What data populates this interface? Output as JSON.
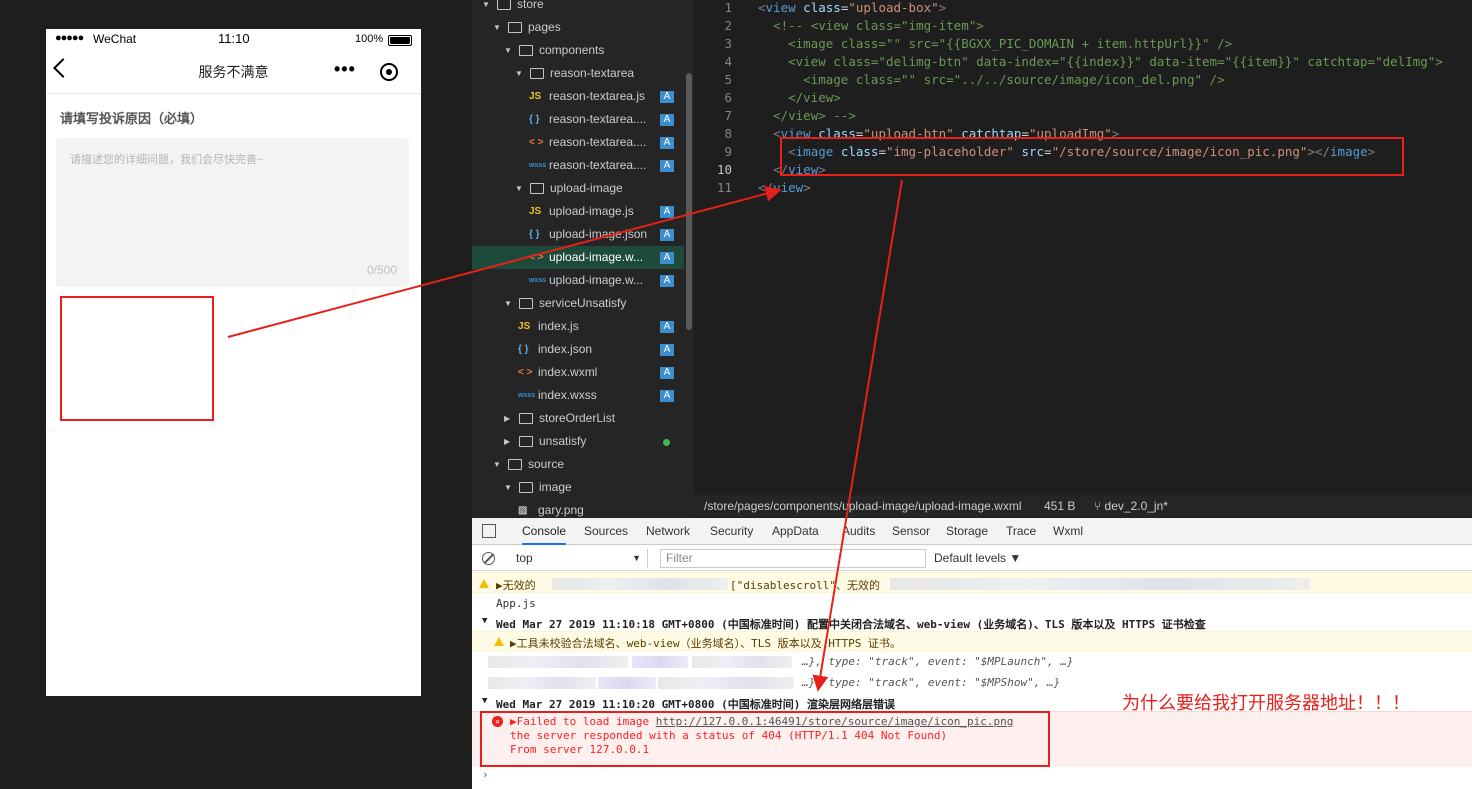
{
  "phone": {
    "signal": "●●●●●",
    "carrier": "WeChat",
    "time": "11:10",
    "battery_pct": "100%",
    "nav_title": "服务不满意",
    "more": "•••",
    "section_title": "请填写投诉原因（必填）",
    "textarea_placeholder": "请描述您的详细问题，我们会尽快完善~",
    "char_count": "0/500"
  },
  "tree": {
    "items": [
      {
        "label": "store",
        "kind": "folder",
        "open": true,
        "indent": 0
      },
      {
        "label": "pages",
        "kind": "folder",
        "open": true,
        "indent": 1
      },
      {
        "label": "components",
        "kind": "folder",
        "open": true,
        "indent": 2
      },
      {
        "label": "reason-textarea",
        "kind": "folder",
        "open": true,
        "indent": 3
      },
      {
        "label": "reason-textarea.js",
        "kind": "js",
        "icon": "JS",
        "badge": "A",
        "indent": 4
      },
      {
        "label": "reason-textarea....",
        "kind": "json",
        "icon": "{ }",
        "badge": "A",
        "indent": 4
      },
      {
        "label": "reason-textarea....",
        "kind": "wxml",
        "icon": "< >",
        "badge": "A",
        "indent": 4
      },
      {
        "label": "reason-textarea....",
        "kind": "wxss",
        "icon": "wxss",
        "badge": "A",
        "indent": 4
      },
      {
        "label": "upload-image",
        "kind": "folder",
        "open": true,
        "indent": 3
      },
      {
        "label": "upload-image.js",
        "kind": "js",
        "icon": "JS",
        "badge": "A",
        "indent": 4
      },
      {
        "label": "upload-image.json",
        "kind": "json",
        "icon": "{ }",
        "badge": "A",
        "indent": 4
      },
      {
        "label": "upload-image.w...",
        "kind": "wxml",
        "icon": "< >",
        "badge": "A",
        "indent": 4,
        "selected": true
      },
      {
        "label": "upload-image.w...",
        "kind": "wxss",
        "icon": "wxss",
        "badge": "A",
        "indent": 4
      },
      {
        "label": "serviceUnsatisfy",
        "kind": "folder",
        "open": true,
        "indent": 2
      },
      {
        "label": "index.js",
        "kind": "js",
        "icon": "JS",
        "badge": "A",
        "indent": 3
      },
      {
        "label": "index.json",
        "kind": "json",
        "icon": "{ }",
        "badge": "A",
        "indent": 3
      },
      {
        "label": "index.wxml",
        "kind": "wxml",
        "icon": "< >",
        "badge": "A",
        "indent": 3
      },
      {
        "label": "index.wxss",
        "kind": "wxss",
        "icon": "wxss",
        "badge": "A",
        "indent": 3
      },
      {
        "label": "storeOrderList",
        "kind": "folder",
        "open": false,
        "indent": 2
      },
      {
        "label": "unsatisfy",
        "kind": "folder",
        "open": false,
        "indent": 2,
        "dot": true
      },
      {
        "label": "source",
        "kind": "folder",
        "open": true,
        "indent": 1
      },
      {
        "label": "image",
        "kind": "folder",
        "open": true,
        "indent": 2
      },
      {
        "label": "gary.png",
        "kind": "png",
        "icon": "▨",
        "indent": 3
      }
    ]
  },
  "editor": {
    "lines": [
      {
        "n": "1",
        "html": "<span class=\"pu\">&lt;</span><span class=\"tg\">view</span> <span class=\"at\">class</span>=<span class=\"st\">\"upload-box\"</span><span class=\"pu\">&gt;</span>"
      },
      {
        "n": "2",
        "html": "  <span class=\"cm\">&lt;!-- &lt;view class=\"img-item\"&gt;</span>"
      },
      {
        "n": "3",
        "html": "    <span class=\"cm\">&lt;image class=\"\" src=\"{{BGXX_PIC_DOMAIN + item.httpUrl}}\" /&gt;</span>"
      },
      {
        "n": "4",
        "html": "    <span class=\"cm\">&lt;view class=\"delimg-btn\" data-index=\"{{index}}\" data-item=\"{{item}}\" catchtap=\"delImg\"&gt;</span>"
      },
      {
        "n": "5",
        "html": "      <span class=\"cm\">&lt;image class=\"\" src=\"../../source/image/icon_del.png\" /&gt;</span>"
      },
      {
        "n": "6",
        "html": "    <span class=\"cm\">&lt;/view&gt;</span>"
      },
      {
        "n": "7",
        "html": "  <span class=\"cm\">&lt;/view&gt; --&gt;</span>"
      },
      {
        "n": "8",
        "html": "  <span class=\"pu\">&lt;</span><span class=\"tg\">view</span> <span class=\"at\">class</span>=<span class=\"st\">\"upload-btn\"</span> <span class=\"at\">catchtap</span>=<span class=\"st\">\"uploadImg\"</span><span class=\"pu\">&gt;</span>"
      },
      {
        "n": "9",
        "html": "    <span class=\"pu\">&lt;</span><span class=\"tg\">image</span> <span class=\"at\">class</span>=<span class=\"st\">\"img-placeholder\"</span> <span class=\"at\">src</span>=<span class=\"st\">\"/store/source/image/icon_pic.png\"</span><span class=\"pu\">&gt;&lt;/</span><span class=\"tg\">image</span><span class=\"pu\">&gt;</span>"
      },
      {
        "n": "10",
        "html": "  <span class=\"pu\">&lt;/</span><span class=\"tg\">view</span><span class=\"pu\">&gt;</span>",
        "current": true
      },
      {
        "n": "11",
        "html": "<span class=\"pu\">&lt;/</span><span class=\"tg\">view</span><span class=\"pu\">&gt;</span>"
      }
    ]
  },
  "statusline": {
    "path": "/store/pages/components/upload-image/upload-image.wxml",
    "size": "451 B",
    "branch": "dev_2.0_jn*"
  },
  "devtools": {
    "tabs": [
      "Console",
      "Sources",
      "Network",
      "Security",
      "AppData",
      "Audits",
      "Sensor",
      "Storage",
      "Trace",
      "Wxml"
    ],
    "active_tab": "Console",
    "context": "top",
    "filter_placeholder": "Filter",
    "levels": "Default levels ▼",
    "log": {
      "warn1_prefix": "▶无效的",
      "warn1_mid": "[\"disablescroll\"、无效的",
      "source1": "App.js",
      "group1": "Wed Mar 27 2019 11:10:18 GMT+0800 (中国标准时间) 配置中关闭合法域名、web-view (业务域名)、TLS 版本以及 HTTPS 证书检查",
      "warn2": "▶工具未校验合法域名、web-view（业务域名）、TLS 版本以及 HTTPS 证书。",
      "track1_tail": "…}, type: \"track\", event: \"$MPLaunch\", …}",
      "track2_tail": "…}, type: \"track\", event: \"$MPShow\", …}",
      "group2": "Wed Mar 27 2019 11:10:20 GMT+0800 (中国标准时间) 渲染层网络层错误",
      "err_prefix": "▶Failed to load image ",
      "err_url": "http://127.0.0.1:46491/store/source/image/icon_pic.png",
      "err_line2": "the server responded with a status of 404 (HTTP/1.1 404 Not Found)",
      "err_line3": "From server 127.0.0.1"
    }
  },
  "annotation": "为什么要给我打开服务器地址！！！",
  "colors": {
    "highlight": "#e8201a",
    "badge": "#3c8fcf",
    "selected": "#1e4a3b"
  }
}
